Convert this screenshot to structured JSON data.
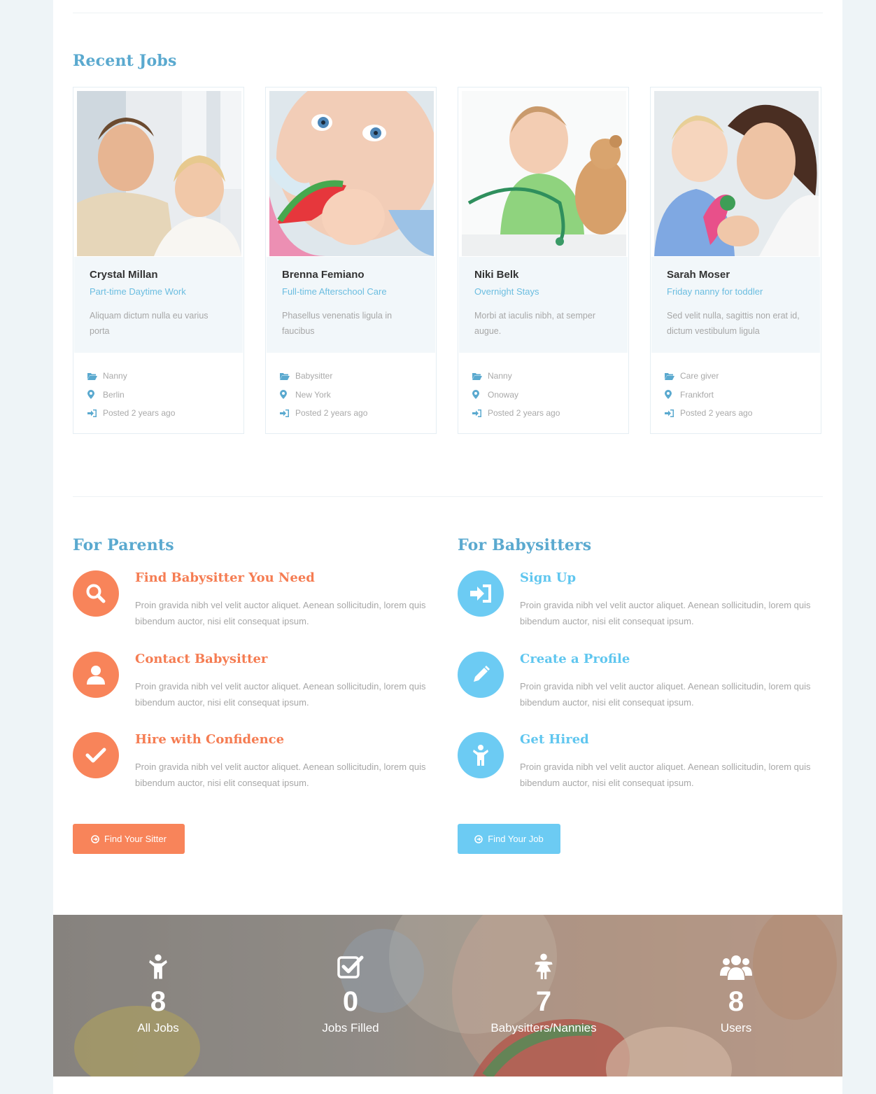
{
  "recent_jobs": {
    "title": "Recent Jobs",
    "jobs": [
      {
        "name": "Crystal Millan",
        "title": "Part-time Daytime Work",
        "description": "Aliquam dictum nulla eu varius porta",
        "category": "Nanny",
        "location": "Berlin",
        "posted": "Posted 2 years ago"
      },
      {
        "name": "Brenna Femiano",
        "title": "Full-time Afterschool Care",
        "description": "Phasellus venenatis ligula in faucibus",
        "category": "Babysitter",
        "location": "New York",
        "posted": "Posted 2 years ago"
      },
      {
        "name": "Niki Belk",
        "title": "Overnight Stays",
        "description": "Morbi at iaculis nibh, at semper augue.",
        "category": "Nanny",
        "location": "Onoway",
        "posted": "Posted 2 years ago"
      },
      {
        "name": "Sarah Moser",
        "title": "Friday nanny for toddler",
        "description": "Sed velit nulla, sagittis non erat id, dictum vestibulum ligula",
        "category": "Care giver",
        "location": "Frankfort",
        "posted": "Posted 2 years ago"
      }
    ]
  },
  "parents": {
    "title": "For Parents",
    "features": [
      {
        "title": "Find Babysitter You Need",
        "text": "Proin gravida nibh vel velit auctor aliquet. Aenean sollicitudin, lorem quis bibendum auctor, nisi elit consequat ipsum.",
        "icon": "search-icon"
      },
      {
        "title": "Contact Babysitter",
        "text": "Proin gravida nibh vel velit auctor aliquet. Aenean sollicitudin, lorem quis bibendum auctor, nisi elit consequat ipsum.",
        "icon": "user-icon"
      },
      {
        "title": "Hire with Confidence",
        "text": "Proin gravida nibh vel velit auctor aliquet. Aenean sollicitudin, lorem quis bibendum auctor, nisi elit consequat ipsum.",
        "icon": "check-icon"
      }
    ],
    "button_label": "Find Your Sitter"
  },
  "babysitters": {
    "title": "For Babysitters",
    "features": [
      {
        "title": "Sign Up",
        "text": "Proin gravida nibh vel velit auctor aliquet. Aenean sollicitudin, lorem quis bibendum auctor, nisi elit consequat ipsum.",
        "icon": "sign-in-icon"
      },
      {
        "title": "Create a Profile",
        "text": "Proin gravida nibh vel velit auctor aliquet. Aenean sollicitudin, lorem quis bibendum auctor, nisi elit consequat ipsum.",
        "icon": "pencil-icon"
      },
      {
        "title": "Get Hired",
        "text": "Proin gravida nibh vel velit auctor aliquet. Aenean sollicitudin, lorem quis bibendum auctor, nisi elit consequat ipsum.",
        "icon": "child-icon"
      }
    ],
    "button_label": "Find Your Job"
  },
  "stats": [
    {
      "value": "8",
      "label": "All Jobs",
      "icon": "child-icon"
    },
    {
      "value": "0",
      "label": "Jobs Filled",
      "icon": "checkbox-icon"
    },
    {
      "value": "7",
      "label": "Babysitters/Nannies",
      "icon": "female-icon"
    },
    {
      "value": "8",
      "label": "Users",
      "icon": "users-icon"
    }
  ],
  "colors": {
    "accent_blue": "#5aa9cf",
    "light_blue": "#6ccbf3",
    "orange": "#f8845a"
  }
}
